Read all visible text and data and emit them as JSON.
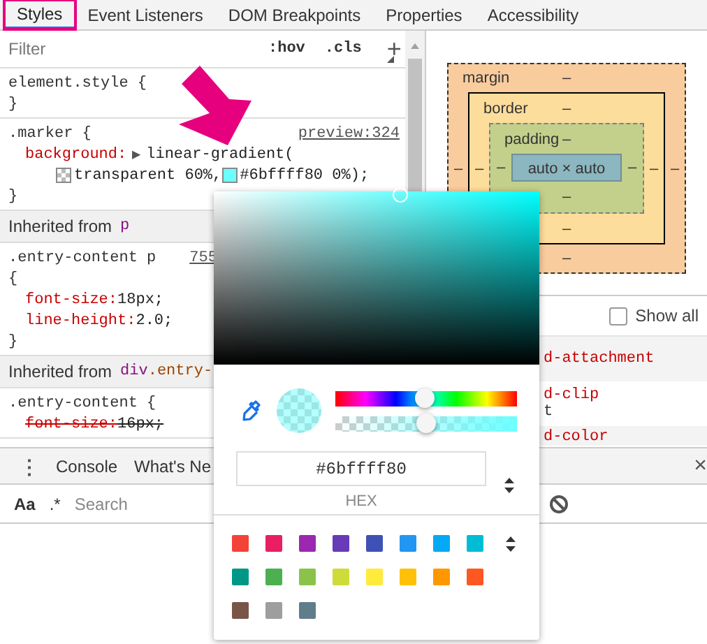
{
  "tabs": [
    {
      "label": "Styles",
      "selected": true,
      "highlighted": true
    },
    {
      "label": "Event Listeners",
      "selected": false,
      "highlighted": false
    },
    {
      "label": "DOM Breakpoints",
      "selected": false,
      "highlighted": false
    },
    {
      "label": "Properties",
      "selected": false,
      "highlighted": false
    },
    {
      "label": "Accessibility",
      "selected": false,
      "highlighted": false
    }
  ],
  "filter": {
    "placeholder": "Filter"
  },
  "filter_buttons": [
    ":hov",
    ".cls"
  ],
  "new_rule_button": "+",
  "rules": [
    {
      "kind": "rule",
      "selector": "element.style {",
      "lines": [
        {
          "kind": "brace",
          "text": "}"
        }
      ]
    },
    {
      "kind": "rule",
      "selector": ".marker {",
      "source": "preview:324",
      "lines": [
        {
          "kind": "decl",
          "property": "background:",
          "expander": "▶",
          "value": "linear-gradient(",
          "struck": false
        },
        {
          "kind": "values",
          "items": [
            {
              "kind": "checker-swatch"
            },
            {
              "kind": "text",
              "text": "transparent 60%,"
            },
            {
              "kind": "swatch",
              "color": "#6bffff"
            },
            {
              "kind": "text",
              "text": "#6bffff80 0%);"
            }
          ]
        },
        {
          "kind": "brace",
          "text": "}"
        }
      ]
    },
    {
      "kind": "inherited",
      "label": "Inherited from",
      "tag": "p"
    },
    {
      "kind": "rule",
      "selector": ".entry-content p",
      "source": "755",
      "lines": [
        {
          "kind": "open-brace",
          "text": "{"
        },
        {
          "kind": "decl",
          "property": "font-size:",
          "value": "18px;",
          "struck": false
        },
        {
          "kind": "decl",
          "property": "line-height:",
          "value": "2.0;",
          "struck": false
        },
        {
          "kind": "brace",
          "text": "}"
        }
      ]
    },
    {
      "kind": "inherited",
      "label": "Inherited from",
      "tag": "div",
      "cls": ".entry-"
    },
    {
      "kind": "rule",
      "selector": ".entry-content {",
      "lines": [
        {
          "kind": "decl",
          "property": "font-size:",
          "value": "16px;",
          "struck": true
        }
      ]
    }
  ],
  "box_model": {
    "kind": "margin",
    "label": "margin",
    "top": "–",
    "left": "–",
    "inner": {
      "kind": "border",
      "label": "border",
      "top": "–",
      "left": "–",
      "inner": {
        "kind": "padding",
        "label": "padding",
        "top": "–",
        "left": "–",
        "inner": {
          "kind": "content",
          "text": "auto × auto"
        },
        "right": "–",
        "bottom": "–"
      },
      "right": "–",
      "bottom": "–"
    },
    "right": "–",
    "bottom": "–"
  },
  "computed": {
    "show_all": {
      "label": "Show all",
      "checked": false
    },
    "rows": [
      {
        "name": "d-attachment"
      },
      {
        "name": "d-clip",
        "value": "t"
      },
      {
        "name": "d-color"
      }
    ]
  },
  "drawer": {
    "menu": "⋮",
    "tabs": [
      "Console",
      "What's Ne"
    ],
    "close": "×",
    "toggles": [
      "Aa",
      ".*"
    ],
    "search": {
      "placeholder": "Search"
    }
  },
  "color_picker": {
    "sliders": [
      {
        "kind": "hue",
        "level": 0.49
      },
      {
        "kind": "alpha",
        "level": 0.5
      }
    ],
    "hex": "#6bffff80",
    "format": "HEX",
    "palette": [
      {
        "color": "#f44336"
      },
      {
        "color": "#e91e63"
      },
      {
        "color": "#9c27b0"
      },
      {
        "color": "#673ab7"
      },
      {
        "color": "#3f51b5"
      },
      {
        "color": "#2196f3"
      },
      {
        "color": "#03a9f4"
      },
      {
        "color": "#00bcd4"
      },
      {
        "color": "#009688"
      },
      {
        "color": "#4caf50"
      },
      {
        "color": "#8bc34a"
      },
      {
        "color": "#cddc39"
      },
      {
        "color": "#ffeb3b"
      },
      {
        "color": "#ffc107"
      },
      {
        "color": "#ff9800"
      },
      {
        "color": "#ff5722"
      },
      {
        "color": "#795548"
      },
      {
        "color": "#9e9e9e"
      },
      {
        "color": "#607d8b"
      }
    ]
  }
}
